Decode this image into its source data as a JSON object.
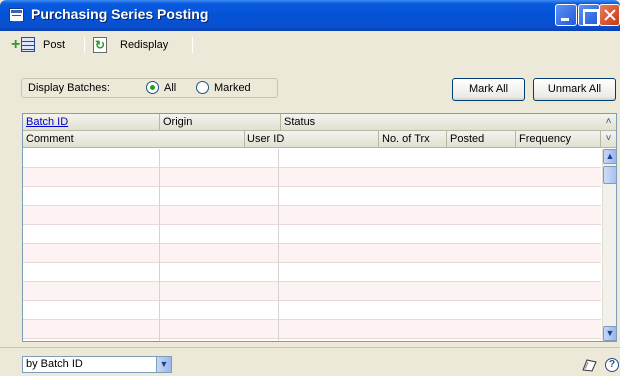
{
  "window": {
    "title": "Purchasing Series Posting"
  },
  "toolbar": {
    "post_label": "Post",
    "redisplay_label": "Redisplay"
  },
  "filter": {
    "display_label": "Display Batches:",
    "options": [
      {
        "label": "All",
        "selected": true
      },
      {
        "label": "Marked",
        "selected": false
      }
    ]
  },
  "buttons": {
    "mark_all": "Mark All",
    "unmark_all": "Unmark All"
  },
  "grid": {
    "header_row1": {
      "batch_id": "Batch ID",
      "origin": "Origin",
      "status": "Status"
    },
    "header_row2": {
      "comment": "Comment",
      "user_id": "User ID",
      "no_of_trx": "No. of Trx",
      "posted": "Posted",
      "frequency": "Frequency"
    },
    "rows": []
  },
  "bottom": {
    "sort_by": "by Batch ID"
  },
  "icons": {
    "post": "post-icon",
    "redisplay": "refresh-icon",
    "note": "note-icon",
    "help": "help-icon"
  },
  "colors": {
    "title_bar": "#0453d6",
    "window_bg": "#ece9d8",
    "link": "#0000cc",
    "alt_row": "#fdf3f3"
  }
}
